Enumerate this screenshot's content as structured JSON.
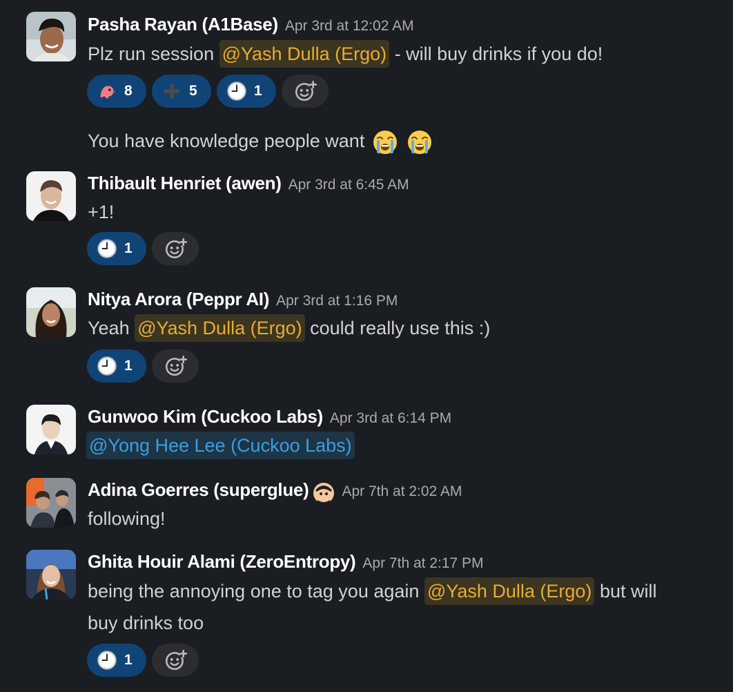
{
  "messages": [
    {
      "author": "Pasha Rayan (A1Base)",
      "timestamp": "Apr 3rd at 12:02 AM",
      "text_before": "Plz run session",
      "mention": "@Yash Dulla (Ergo)",
      "text_after": "- will buy drinks if you do!",
      "reactions": [
        {
          "icon": "party-parrot-icon",
          "count": "8"
        },
        {
          "icon": "plus-icon",
          "count": "5"
        },
        {
          "icon": "clock-icon",
          "count": "1"
        }
      ],
      "followup_text": "You have knowledge people want",
      "followup_emojis": [
        "loudly-crying-face-icon",
        "loudly-crying-face-icon"
      ]
    },
    {
      "author": "Thibault Henriet (awen)",
      "timestamp": "Apr 3rd at 6:45 AM",
      "text": "+1!",
      "reactions": [
        {
          "icon": "clock-icon",
          "count": "1"
        }
      ]
    },
    {
      "author": "Nitya Arora (Peppr AI)",
      "timestamp": "Apr 3rd at 1:16 PM",
      "text_before": "Yeah",
      "mention": "@Yash Dulla (Ergo)",
      "text_after": "could really use this :)",
      "reactions": [
        {
          "icon": "clock-icon",
          "count": "1"
        }
      ]
    },
    {
      "author": "Gunwoo Kim (Cuckoo Labs)",
      "timestamp": "Apr 3rd at 6:14 PM",
      "mention": "@Yong Hee Lee (Cuckoo Labs)"
    },
    {
      "author": "Adina Goerres (superglue)",
      "status_icon": "custom-status-icon",
      "timestamp": "Apr 7th at 2:02 AM",
      "text": "following!"
    },
    {
      "author": "Ghita Houir Alami (ZeroEntropy)",
      "timestamp": "Apr 7th at 2:17 PM",
      "text_before": "being the annoying one to tag you again",
      "mention": "@Yash Dulla (Ergo)",
      "text_after": "but will",
      "text_line2": "buy drinks too",
      "reactions": [
        {
          "icon": "clock-icon",
          "count": "1"
        }
      ]
    }
  ],
  "colors": {
    "background": "#1a1d21",
    "reaction_active": "#104476",
    "mention_yellow": "#e8ad34",
    "mention_blue": "#3b9ee0"
  }
}
